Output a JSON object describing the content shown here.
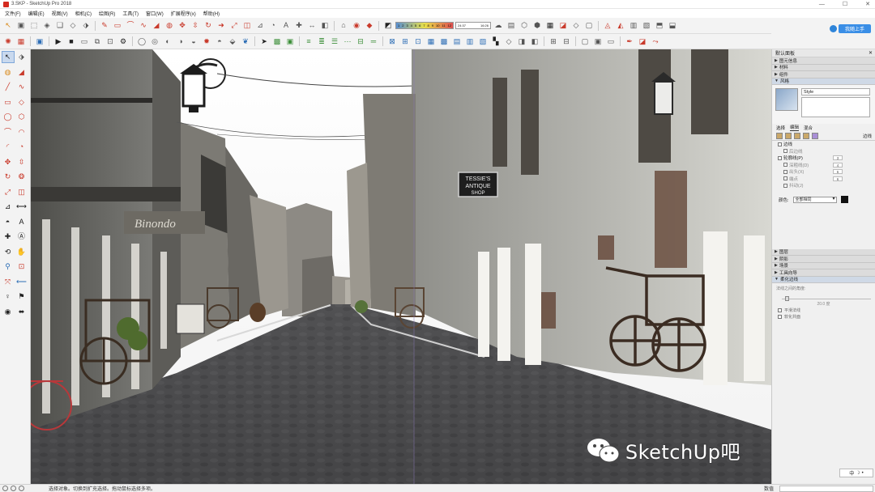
{
  "window": {
    "title": "3.SKP - SketchUp Pro 2018",
    "min": "—",
    "max": "☐",
    "close": "✕"
  },
  "menu": [
    "文件(F)",
    "编辑(E)",
    "视图(V)",
    "相机(C)",
    "绘图(R)",
    "工具(T)",
    "窗口(W)",
    "扩展程序(x)",
    "帮助(H)"
  ],
  "toolbar": {
    "ruler_ticks": [
      "1",
      "2",
      "3",
      "4",
      "5",
      "6",
      "7",
      "8",
      "9",
      "10",
      "11",
      "12"
    ],
    "ruler2_left": "24:37",
    "ruler2_right": "16:26",
    "login_label": "我随上手"
  },
  "tray": {
    "title": "默认面板",
    "close_glyph": "✕",
    "sections_top": [
      "图元信息",
      "材料",
      "组件",
      "风格"
    ],
    "style_name": "Style",
    "tabs": [
      "选择",
      "编辑",
      "混合"
    ],
    "edges_label": "边线",
    "edge_settings": [
      {
        "label": "边线",
        "checked": true,
        "value": ""
      },
      {
        "label": "后边线",
        "checked": false,
        "value": "",
        "sub": true
      },
      {
        "label": "轮廓线(P)",
        "checked": true,
        "value": "3"
      },
      {
        "label": "深粗线(D)",
        "checked": false,
        "value": "4",
        "sub": true
      },
      {
        "label": "出头(X)",
        "checked": false,
        "value": "6",
        "sub": true
      },
      {
        "label": "端点",
        "checked": false,
        "value": "6",
        "sub": true
      },
      {
        "label": "抖动(J)",
        "checked": false,
        "value": "",
        "sub": true
      }
    ],
    "color_label": "颜色:",
    "color_value": "全部相同",
    "sections_bottom": [
      "图层",
      "阴影",
      "场景",
      "工具向导",
      "柔化边线"
    ],
    "soften_label": "法线之间的角度:",
    "soften_deg": "20.0 度",
    "soften_checks": [
      "平滑法线",
      "软化共面"
    ],
    "lang": "中"
  },
  "status": {
    "text": "选择对象。切换到扩充选择。拖动鼠标选择多项。",
    "measure_label": "数值"
  },
  "viewport": {
    "signs": {
      "tessie_line1": "TESSIE'S",
      "tessie_line2": "ANTIQUE",
      "tessie_line3": "SHOP",
      "script_sign": "Binondo"
    }
  },
  "watermark": {
    "text": "SketchUp吧"
  },
  "colors": {
    "accent": "#3a8ee6",
    "brand_red": "#d42a1f"
  }
}
